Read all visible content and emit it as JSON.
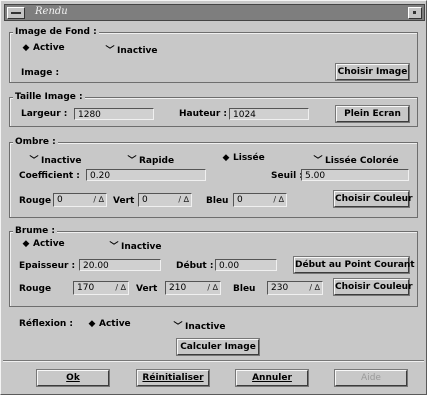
{
  "window": {
    "title": "Rendu"
  },
  "image_de_fond": {
    "title": "Image de Fond :",
    "options": [
      "Active",
      "Inactive"
    ],
    "selected": "Active",
    "image_label": "Image :",
    "choose_button": "Choisir Image"
  },
  "taille_image": {
    "title": "Taille Image :",
    "largeur_label": "Largeur :",
    "largeur_value": "1280",
    "hauteur_label": "Hauteur :",
    "hauteur_value": "1024",
    "fullscreen_button": "Plein Ecran"
  },
  "ombre": {
    "title": "Ombre :",
    "options": [
      "Inactive",
      "Rapide",
      "Lissée",
      "Lissée Colorée"
    ],
    "selected": "Lissée",
    "coefficient_label": "Coefficient :",
    "coefficient_value": "0.20",
    "seuil_label": "Seuil :",
    "seuil_value": "5.00",
    "rouge_label": "Rouge",
    "rouge_value": "0",
    "vert_label": "Vert",
    "vert_value": "0",
    "bleu_label": "Bleu",
    "bleu_value": "0",
    "spin_glyph": "/ ∆",
    "color_button": "Choisir Couleur"
  },
  "brume": {
    "title": "Brume :",
    "options": [
      "Active",
      "Inactive"
    ],
    "selected": "Active",
    "epaisseur_label": "Epaisseur :",
    "epaisseur_value": "20.00",
    "debut_label": "Début :",
    "debut_value": "0.00",
    "debut_button": "Début au Point Courant",
    "rouge_label": "Rouge",
    "rouge_value": "170",
    "vert_label": "Vert",
    "vert_value": "210",
    "bleu_label": "Bleu",
    "bleu_value": "230",
    "spin_glyph": "/ ∆",
    "color_button": "Choisir Couleur"
  },
  "reflexion": {
    "label": "Réflexion :",
    "options": [
      "Active",
      "Inactive"
    ],
    "selected": "Active"
  },
  "calculate_button": "Calculer Image",
  "footer": {
    "ok": "Ok",
    "reset": "Réinitialiser",
    "cancel": "Annuler",
    "help": "Aide"
  },
  "indicators": {
    "on": "◆",
    "off": "﹀"
  }
}
